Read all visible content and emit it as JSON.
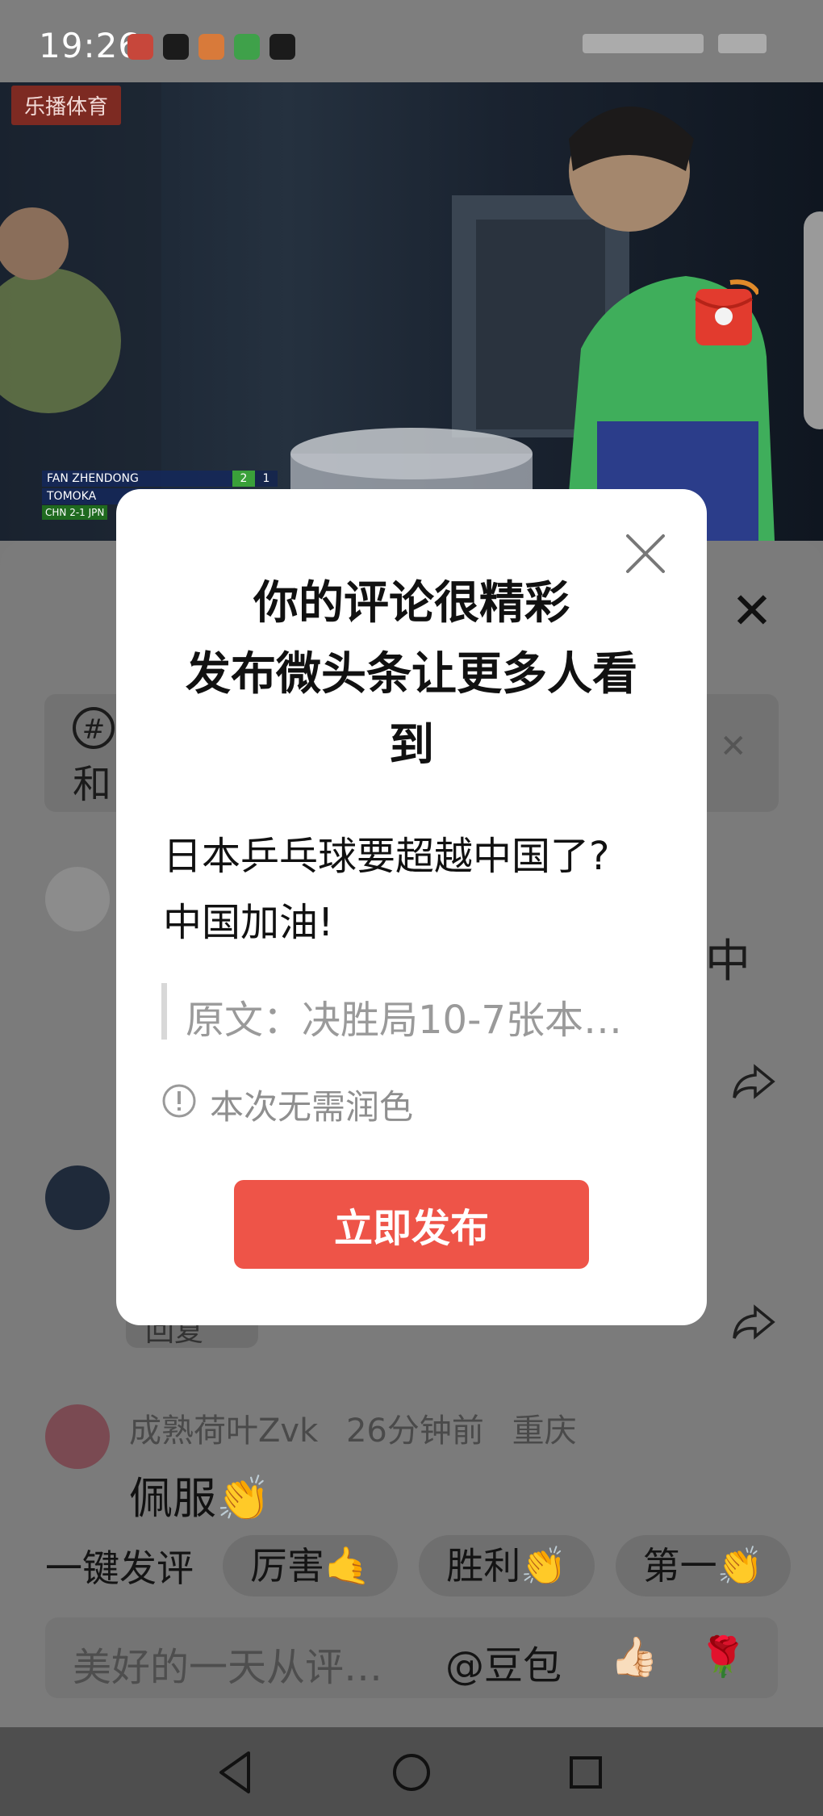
{
  "status_bar": {
    "time": "19:26"
  },
  "video": {
    "broadcaster": "乐播体育",
    "scoreboard": {
      "players": [
        {
          "name": "FAN ZHENDONG",
          "sets": "2",
          "points": "1"
        },
        {
          "name": "TOMOKA",
          "sets": "",
          "points": ""
        }
      ],
      "status": "CHN 2-1 JPN"
    }
  },
  "comments": {
    "topic_text": "和",
    "cut_text": "中",
    "reply_label": "回复",
    "third": {
      "author": "成熟荷叶Zvk",
      "time": "26分钟前",
      "location": "重庆",
      "text": "佩服👏"
    }
  },
  "quick_comment": {
    "label": "一键发评",
    "chips": [
      "厉害🤙",
      "胜利👏",
      "第一👏"
    ]
  },
  "input": {
    "placeholder": "美好的一天从评…",
    "mention": "@豆包",
    "emoji_thumb": "👍🏻",
    "emoji_rose": "🌹"
  },
  "dialog": {
    "title_line1": "你的评论很精彩",
    "title_line2": "发布微头条让更多人看",
    "title_line3": "到",
    "comment_line1": "日本乒乓球要超越中国了?",
    "comment_line2": "中国加油!",
    "quote": "原文：决胜局10-7张本…",
    "tip": "本次无需润色",
    "publish_button": "立即发布"
  },
  "colors": {
    "accent": "#ee5448",
    "overlay": "#7b7b7b"
  }
}
